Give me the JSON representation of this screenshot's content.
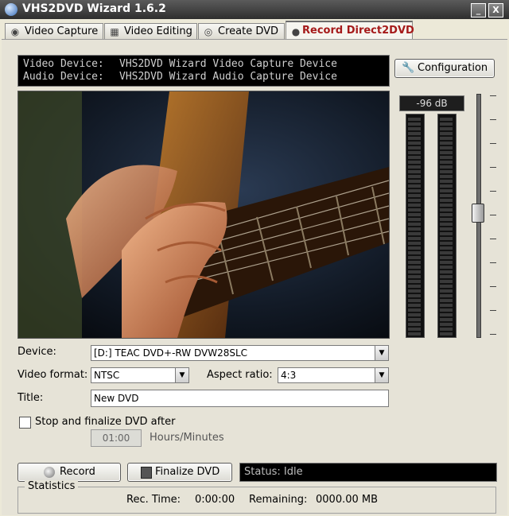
{
  "window": {
    "title": "VHS2DVD Wizard 1.6.2",
    "minimize": "_",
    "close": "X"
  },
  "tabs": [
    {
      "label": "Video Capture",
      "icon": "camera-icon"
    },
    {
      "label": "Video Editing",
      "icon": "film-icon"
    },
    {
      "label": "Create DVD",
      "icon": "disc-icon"
    },
    {
      "label": "Record Direct2DVD",
      "icon": "record-icon",
      "active": true
    }
  ],
  "device_info": {
    "video_label": "Video Device:",
    "video_value": "VHS2DVD Wizard Video Capture Device",
    "audio_label": "Audio Device:",
    "audio_value": "VHS2DVD Wizard Audio Capture Device"
  },
  "configuration_label": "Configuration",
  "meter": {
    "db": "-96 dB",
    "left_level": 0,
    "right_level": 0
  },
  "form": {
    "device_label": "Device:",
    "device_value": "[D:] TEAC    DVD+-RW    DVW28SLC",
    "video_format_label": "Video format:",
    "video_format_value": "NTSC",
    "aspect_ratio_label": "Aspect ratio:",
    "aspect_ratio_value": "4:3",
    "title_label": "Title:",
    "title_value": "New DVD",
    "stop_finalize_label": "Stop and finalize DVD after",
    "stop_finalize_checked": false,
    "time_value": "01:00",
    "hours_minutes_label": "Hours/Minutes"
  },
  "actions": {
    "record": "Record",
    "finalize": "Finalize DVD"
  },
  "status": "Status: Idle",
  "statistics": {
    "legend": "Statistics",
    "rec_time_label": "Rec. Time:",
    "rec_time_value": "0:00:00",
    "remaining_label": "Remaining:",
    "remaining_value": "0000.00 MB"
  },
  "colors": {
    "active_tab": "#a51a1a",
    "status_bg": "#000000"
  }
}
